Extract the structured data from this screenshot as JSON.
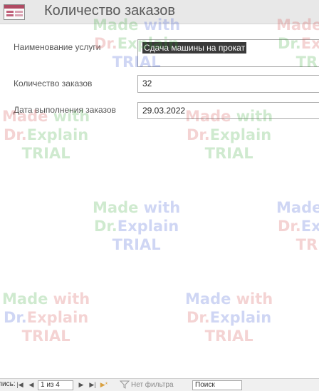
{
  "header": {
    "title": "Количество заказов",
    "icon": "form-icon"
  },
  "fields": [
    {
      "label": "Наименование услуги",
      "value": "Сдача машины на прокат"
    },
    {
      "label": "Количество заказов",
      "value": "32"
    },
    {
      "label": "Дата выполнения заказов",
      "value": "29.03.2022"
    }
  ],
  "watermark": {
    "line1_a": "Made",
    "line1_b": "with",
    "line2_a": "Dr.",
    "line2_b": "Explain",
    "line3": "TRIAL"
  },
  "navigation": {
    "records_label": "Запись:",
    "position": "1 из 4",
    "filter_label": "Нет фильтра",
    "search_placeholder": "Поиск",
    "first_icon": "first-record-icon",
    "prev_icon": "previous-record-icon",
    "next_icon": "next-record-icon",
    "last_icon": "last-record-icon",
    "new_icon": "new-record-icon"
  },
  "colors": {
    "header_bg": "#e8e8e8",
    "icon_accent": "#b04a63",
    "selection_bg": "#3a3a3a"
  }
}
